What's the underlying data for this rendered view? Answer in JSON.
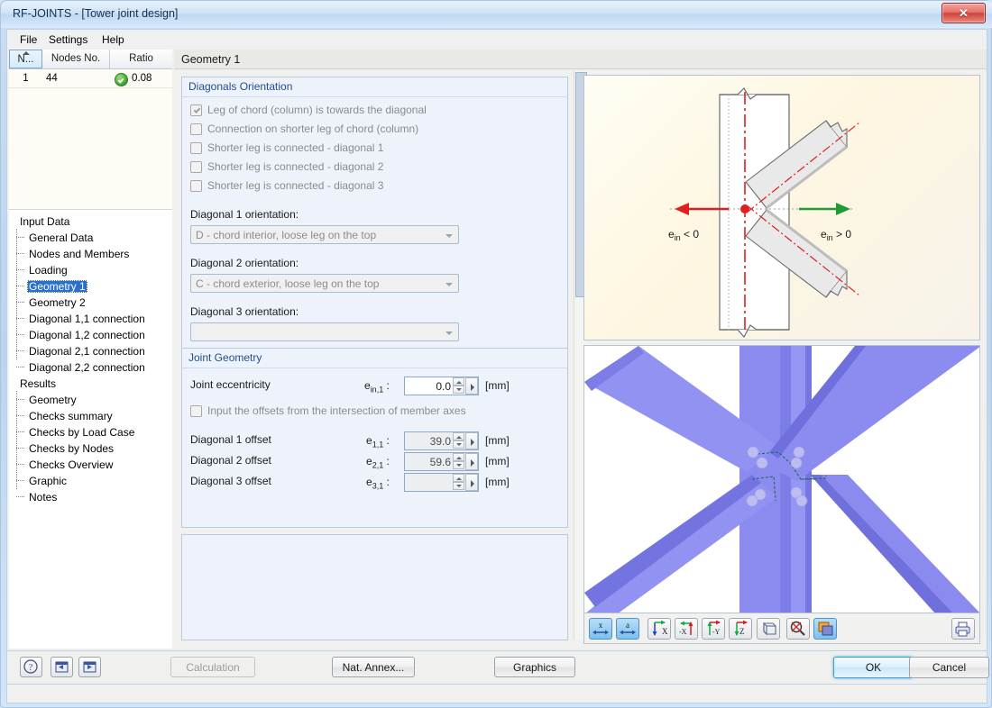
{
  "window": {
    "title": "RF-JOINTS - [Tower joint design]",
    "close_label": "✕"
  },
  "menu": [
    {
      "label": "File"
    },
    {
      "label": "Settings"
    },
    {
      "label": "Help"
    }
  ],
  "node_grid": {
    "columns": [
      "N...",
      "Nodes No.",
      "Ratio"
    ],
    "rows": [
      {
        "no": "1",
        "node": "44",
        "ratio": "0.08",
        "status": "ok"
      }
    ]
  },
  "tree": {
    "groups": [
      {
        "label": "Input Data",
        "items": [
          {
            "label": "General Data",
            "selected": false
          },
          {
            "label": "Nodes and Members",
            "selected": false
          },
          {
            "label": "Loading",
            "selected": false
          },
          {
            "label": "Geometry 1",
            "selected": true
          },
          {
            "label": "Geometry 2",
            "selected": false
          },
          {
            "label": "Diagonal 1,1 connection",
            "selected": false
          },
          {
            "label": "Diagonal 1,2 connection",
            "selected": false
          },
          {
            "label": "Diagonal 2,1 connection",
            "selected": false
          },
          {
            "label": "Diagonal 2,2 connection",
            "selected": false
          }
        ]
      },
      {
        "label": "Results",
        "items": [
          {
            "label": "Geometry",
            "selected": false
          },
          {
            "label": "Checks summary",
            "selected": false
          },
          {
            "label": "Checks by Load Case",
            "selected": false
          },
          {
            "label": "Checks by Nodes",
            "selected": false
          },
          {
            "label": "Checks Overview",
            "selected": false
          },
          {
            "label": "Graphic",
            "selected": false
          },
          {
            "label": "Notes",
            "selected": false
          }
        ]
      }
    ]
  },
  "page": {
    "title": "Geometry 1"
  },
  "diagonals_orientation": {
    "title": "Diagonals Orientation",
    "checkboxes": [
      {
        "label": "Leg of chord (column) is towards the diagonal",
        "checked": true,
        "enabled": false
      },
      {
        "label": "Connection on shorter leg of chord (column)",
        "checked": false,
        "enabled": false
      },
      {
        "label": "Shorter leg is connected - diagonal 1",
        "checked": false,
        "enabled": false
      },
      {
        "label": "Shorter leg is connected - diagonal 2",
        "checked": false,
        "enabled": false
      },
      {
        "label": "Shorter leg is connected - diagonal 3",
        "checked": false,
        "enabled": false
      }
    ],
    "selects": [
      {
        "label": "Diagonal 1 orientation:",
        "value": "D - chord interior, loose leg on the top"
      },
      {
        "label": "Diagonal 2 orientation:",
        "value": "C - chord exterior, loose leg on the top"
      },
      {
        "label": "Diagonal 3 orientation:",
        "value": ""
      }
    ]
  },
  "joint_geometry": {
    "title": "Joint Geometry",
    "eccentricity": {
      "label": "Joint eccentricity",
      "symbol": "e",
      "subscript": "in,1",
      "value": "0.0",
      "unit": "[mm]",
      "enabled": true
    },
    "offsets_checkbox": {
      "label": "Input the offsets from the intersection of member axes",
      "checked": false,
      "enabled": false
    },
    "offsets": [
      {
        "label": "Diagonal 1 offset",
        "symbol": "e",
        "subscript": "1,1",
        "value": "39.0",
        "unit": "[mm]",
        "enabled": false
      },
      {
        "label": "Diagonal 2 offset",
        "symbol": "e",
        "subscript": "2,1",
        "value": "59.6",
        "unit": "[mm]",
        "enabled": false
      },
      {
        "label": "Diagonal 3 offset",
        "symbol": "e",
        "subscript": "3,1",
        "value": "",
        "unit": "[mm]",
        "enabled": false
      }
    ]
  },
  "diagram": {
    "label_negative": "e",
    "label_negative_sub": "in",
    "label_negative_op": " < 0",
    "label_positive": "e",
    "label_positive_sub": "in",
    "label_positive_op": " > 0",
    "arrow_negative_color": "#e02020",
    "arrow_positive_color": "#1f9a35",
    "axis_color": "#e02020"
  },
  "gfx_toolbar": {
    "buttons": [
      {
        "name": "zoom-x-icon",
        "label": "x",
        "active": true
      },
      {
        "name": "zoom-a-icon",
        "label": "a",
        "active": true
      },
      {
        "name": "view-x-icon",
        "label": "X",
        "active": false
      },
      {
        "name": "view-minus-x-icon",
        "label": "-X",
        "active": false
      },
      {
        "name": "view-minus-y-icon",
        "label": "-Y",
        "active": false
      },
      {
        "name": "view-z-icon",
        "label": "Z",
        "active": false
      },
      {
        "name": "isometric-view-icon",
        "label": "",
        "active": false
      },
      {
        "name": "zoom-tool-icon",
        "label": "",
        "active": false
      },
      {
        "name": "layers-icon",
        "label": "",
        "active": true
      }
    ],
    "print_button": {
      "name": "print-icon"
    }
  },
  "footer": {
    "help_button": "?",
    "prev_button": "◀",
    "next_button": "▶",
    "calculation": {
      "label": "Calculation",
      "enabled": false
    },
    "nat_annex": {
      "label": "Nat. Annex...",
      "enabled": true
    },
    "graphics": {
      "label": "Graphics",
      "enabled": true
    },
    "ok": {
      "label": "OK",
      "enabled": true,
      "default": true
    },
    "cancel": {
      "label": "Cancel",
      "enabled": true
    }
  }
}
